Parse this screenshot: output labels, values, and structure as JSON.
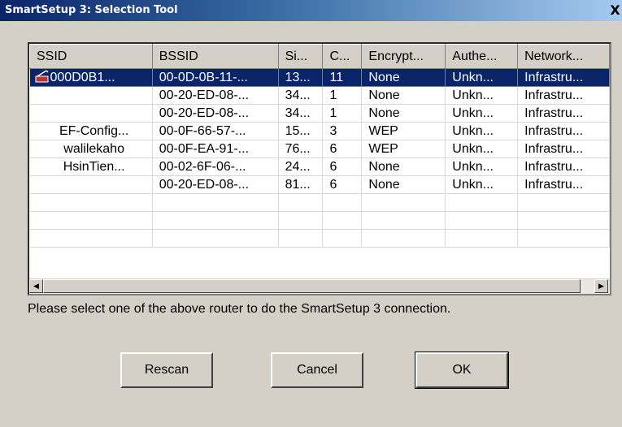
{
  "window": {
    "title": "SmartSetup 3: Selection Tool",
    "close_label": "X"
  },
  "table": {
    "columns": [
      "SSID",
      "BSSID",
      "Si...",
      "C...",
      "Encrypt...",
      "Authe...",
      "Network..."
    ],
    "rows": [
      [
        "000D0B1...",
        "00-0D-0B-11-...",
        "13...",
        "11",
        "None",
        "Unkn...",
        "Infrastru..."
      ],
      [
        "",
        "00-20-ED-08-...",
        "34...",
        "1",
        "None",
        "Unkn...",
        "Infrastru..."
      ],
      [
        "",
        "00-20-ED-08-...",
        "34...",
        "1",
        "None",
        "Unkn...",
        "Infrastru..."
      ],
      [
        "EF-Config...",
        "00-0F-66-57-...",
        "15...",
        "3",
        "WEP",
        "Unkn...",
        "Infrastru..."
      ],
      [
        "walilekaho",
        "00-0F-EA-91-...",
        "76...",
        "6",
        "WEP",
        "Unkn...",
        "Infrastru..."
      ],
      [
        "HsinTien...",
        "00-02-6F-06-...",
        "24...",
        "6",
        "None",
        "Unkn...",
        "Infrastru..."
      ],
      [
        "",
        "00-20-ED-08-...",
        "81...",
        "6",
        "None",
        "Unkn...",
        "Infrastru..."
      ]
    ],
    "selected_row": 0,
    "empty_rows": 3
  },
  "message": "Please select one of the above router to do the SmartSetup 3 connection.",
  "buttons": {
    "rescan": "Rescan",
    "cancel": "Cancel",
    "ok": "OK"
  },
  "icons": {
    "selected_row_icon": "router-signal-icon",
    "scroll_left": "scroll-left-arrow-icon",
    "scroll_right": "scroll-right-arrow-icon"
  },
  "colors": {
    "selection": "#0a246a",
    "titlebar_start": "#0a246a",
    "titlebar_end": "#a6caf0",
    "face": "#d4d0c8"
  }
}
